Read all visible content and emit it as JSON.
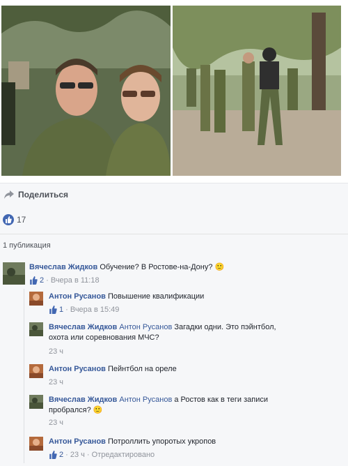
{
  "share": {
    "label": "Поделиться",
    "icon": "share-arrow-icon"
  },
  "likes": {
    "count": "17",
    "icon": "thumbs-up-icon",
    "color": "#4267b2"
  },
  "publications": {
    "label": "1 публикация"
  },
  "comments": [
    {
      "author": "Вячеслав Жидков",
      "mention": "",
      "text": "Обучение? В Ростове-на-Дону? 🙂",
      "likes": "2",
      "time": "· Вчера в 11:18"
    },
    {
      "author": "Антон Русанов",
      "mention": "",
      "text": "Повышение квалификации",
      "likes": "1",
      "time": "· Вчера в 15:49"
    },
    {
      "author": "Вячеслав Жидков",
      "mention": "Антон Русанов",
      "text": "Загадки одни. Это пэйнтбол,",
      "text2": "охота или соревнования МЧС?",
      "likes": "",
      "time": "23 ч"
    },
    {
      "author": "Антон Русанов",
      "mention": "",
      "text": "Пейнтбол на ореле",
      "likes": "",
      "time": "23 ч"
    },
    {
      "author": "Вячеслав Жидков",
      "mention": "Антон Русанов",
      "text": "а Ростов как в теги записи",
      "text2": "пробрался? 🙂",
      "likes": "",
      "time": "23 ч"
    },
    {
      "author": "Антон Русанов",
      "mention": "",
      "text": "Потроллить упоротых укропов",
      "likes": "2",
      "time": "· 23 ч · Отредактировано"
    }
  ]
}
